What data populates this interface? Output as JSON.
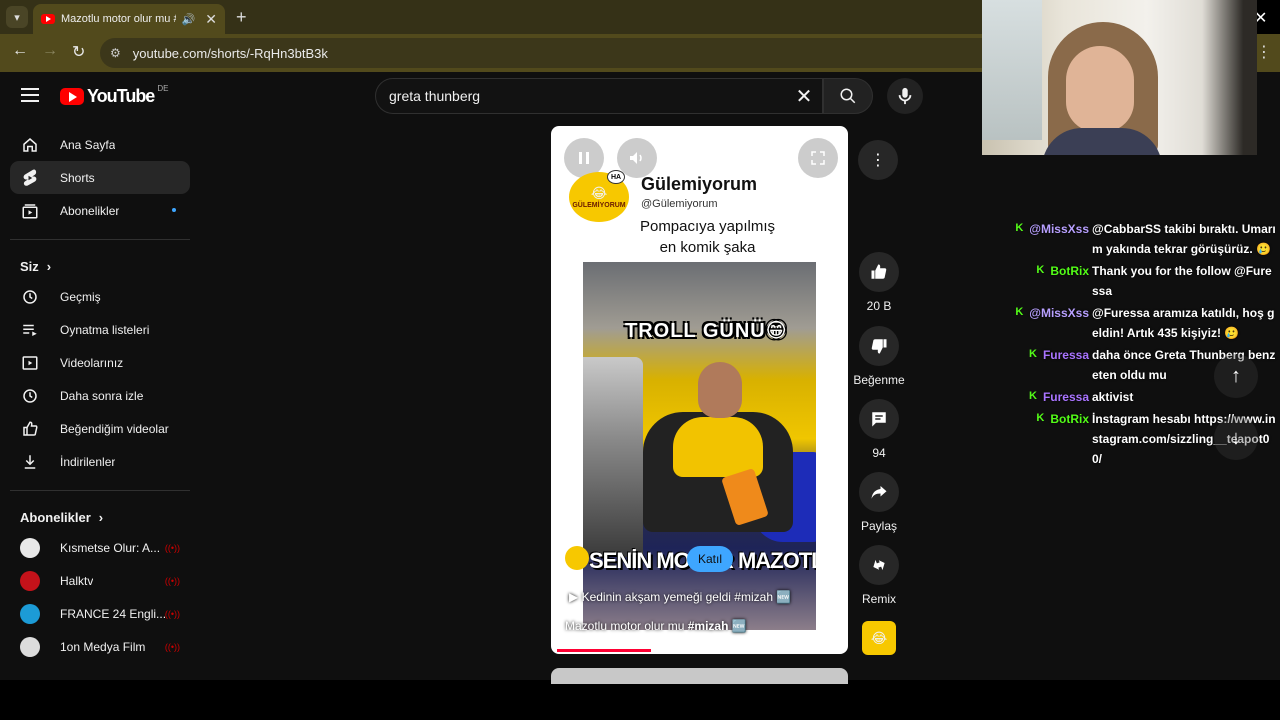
{
  "browser": {
    "tab_title": "Mazotlu motor olur mu #mizah",
    "url": "youtube.com/shorts/-RqHn3btB3k"
  },
  "header": {
    "logo_text": "YouTube",
    "country": "DE",
    "search_value": "greta thunberg"
  },
  "sidebar": {
    "primary": [
      {
        "label": "Ana Sayfa",
        "icon": "home-icon"
      },
      {
        "label": "Shorts",
        "icon": "shorts-icon"
      },
      {
        "label": "Abonelikler",
        "icon": "subscriptions-icon"
      }
    ],
    "you_title": "Siz",
    "you_items": [
      {
        "label": "Geçmiş",
        "icon": "history-icon"
      },
      {
        "label": "Oynatma listeleri",
        "icon": "playlists-icon"
      },
      {
        "label": "Videolarınız",
        "icon": "your-videos-icon"
      },
      {
        "label": "Daha sonra izle",
        "icon": "watch-later-icon"
      },
      {
        "label": "Beğendiğim videolar",
        "icon": "liked-videos-icon"
      },
      {
        "label": "İndirilenler",
        "icon": "downloads-icon"
      }
    ],
    "subs_title": "Abonelikler",
    "subs": [
      {
        "label": "Kısmetse Olur: A...",
        "color": "#e8e8e8"
      },
      {
        "label": "Halktv",
        "color": "#c4121a"
      },
      {
        "label": "FRANCE 24 Engli...",
        "color": "#1c9bd6"
      },
      {
        "label": "1on Medya Film",
        "color": "#dcdcdc"
      }
    ]
  },
  "player": {
    "channel_name": "Gülemiyorum",
    "channel_handle": "@Gülemiyorum",
    "logo_label": "GÜLEMİYORUM",
    "logo_bubble": "HA",
    "caption_line1": "Pompacıya yapılmış",
    "caption_line2": "en komik şaka",
    "overlay_top": "TROLL GÜNÜ😁",
    "overlay_bottom": "SENİN MOTOR MAZOTLU",
    "join_label": "Katıl",
    "suggestion": "Kedinin akşam yemeği geldi #mizah 🆕",
    "title_plain": "Mazotlu motor olur mu ",
    "title_tag": "#mizah",
    "title_emoji": " 🆕",
    "progress": 0.33
  },
  "actions": {
    "likes": "20 B",
    "dislike_label": "Beğenme",
    "comments": "94",
    "share_label": "Paylaş",
    "remix_label": "Remix"
  },
  "chat": [
    {
      "user": "@MissXss",
      "color": "#b8a0ff",
      "msg": "@CabbarSS takibi bıraktı. Umarım yakında tekrar görüşürüz. 🥲"
    },
    {
      "user": "BotRix",
      "color": "#53fc18",
      "msg": "Thank you for the follow @Furessa"
    },
    {
      "user": "@MissXss",
      "color": "#b8a0ff",
      "msg": "@Furessa aramıza katıldı, hoş geldin! Artık 435 kişiyiz! 🥲"
    },
    {
      "user": "Furessa",
      "color": "#a974ff",
      "msg": "daha önce Greta Thunberg benzeten oldu mu"
    },
    {
      "user": "Furessa",
      "color": "#a974ff",
      "msg": "aktivist"
    },
    {
      "user": "BotRix",
      "color": "#53fc18",
      "msg": "İnstagram hesabı https://www.instagram.com/sizzling__teapot00/"
    }
  ]
}
